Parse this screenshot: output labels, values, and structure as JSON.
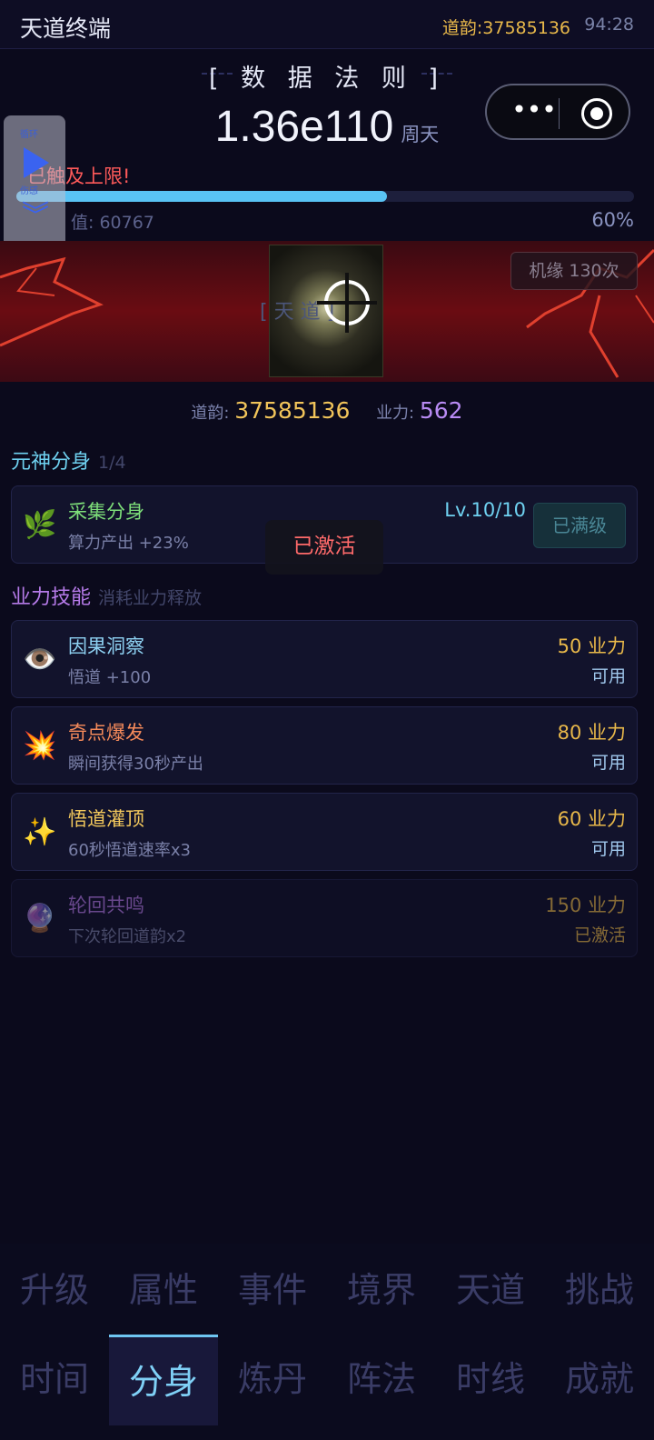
{
  "header": {
    "title": "天道终端",
    "daoyun": "道韵:37585136",
    "time": "94:28"
  },
  "law": {
    "title": "[ 数 据 法 则 ]",
    "value": "1.36e110",
    "unit": "周天"
  },
  "float_panel": {
    "t1": "循环",
    "t2": "伤感",
    "t3": "康哥"
  },
  "progress": {
    "alert": "已触及上限!",
    "left_label": "值: 60767",
    "percent_label": "60%",
    "fraction": 0.6
  },
  "event": {
    "placeholder": "[ 天 道 ]",
    "jiyuan": "机缘 130次"
  },
  "stats": {
    "daoyun_label": "道韵:",
    "daoyun_value": "37585136",
    "yeli_label": "业力:",
    "yeli_value": "562"
  },
  "clones": {
    "title": "元神分身",
    "count": "1/4",
    "items": [
      {
        "icon": "🌿",
        "name": "采集分身",
        "desc": "算力产出 +23%",
        "level": "Lv.10/10",
        "button": "已满级"
      }
    ]
  },
  "toast": "已激活",
  "skills": {
    "title": "业力技能",
    "subtitle": "消耗业力释放",
    "items": [
      {
        "icon": "👁️",
        "name": "因果洞察",
        "desc": "悟道 +100",
        "cost": "50 业力",
        "status": "可用",
        "color": "#8ed1f2"
      },
      {
        "icon": "💥",
        "name": "奇点爆发",
        "desc": "瞬间获得30秒产出",
        "cost": "80 业力",
        "status": "可用",
        "color": "#f58a5a"
      },
      {
        "icon": "✨",
        "name": "悟道灌顶",
        "desc": "60秒悟道速率x3",
        "cost": "60 业力",
        "status": "可用",
        "color": "#f3c85c"
      },
      {
        "icon": "🔮",
        "name": "轮回共鸣",
        "desc": "下次轮回道韵x2",
        "cost": "150 业力",
        "status": "已激活",
        "color": "#b57ae8"
      }
    ]
  },
  "tabs_row1": [
    "升级",
    "属性",
    "事件",
    "境界",
    "天道",
    "挑战"
  ],
  "tabs_row2": [
    "时间",
    "分身",
    "炼丹",
    "阵法",
    "时线",
    "成就"
  ],
  "active_tab": "分身"
}
